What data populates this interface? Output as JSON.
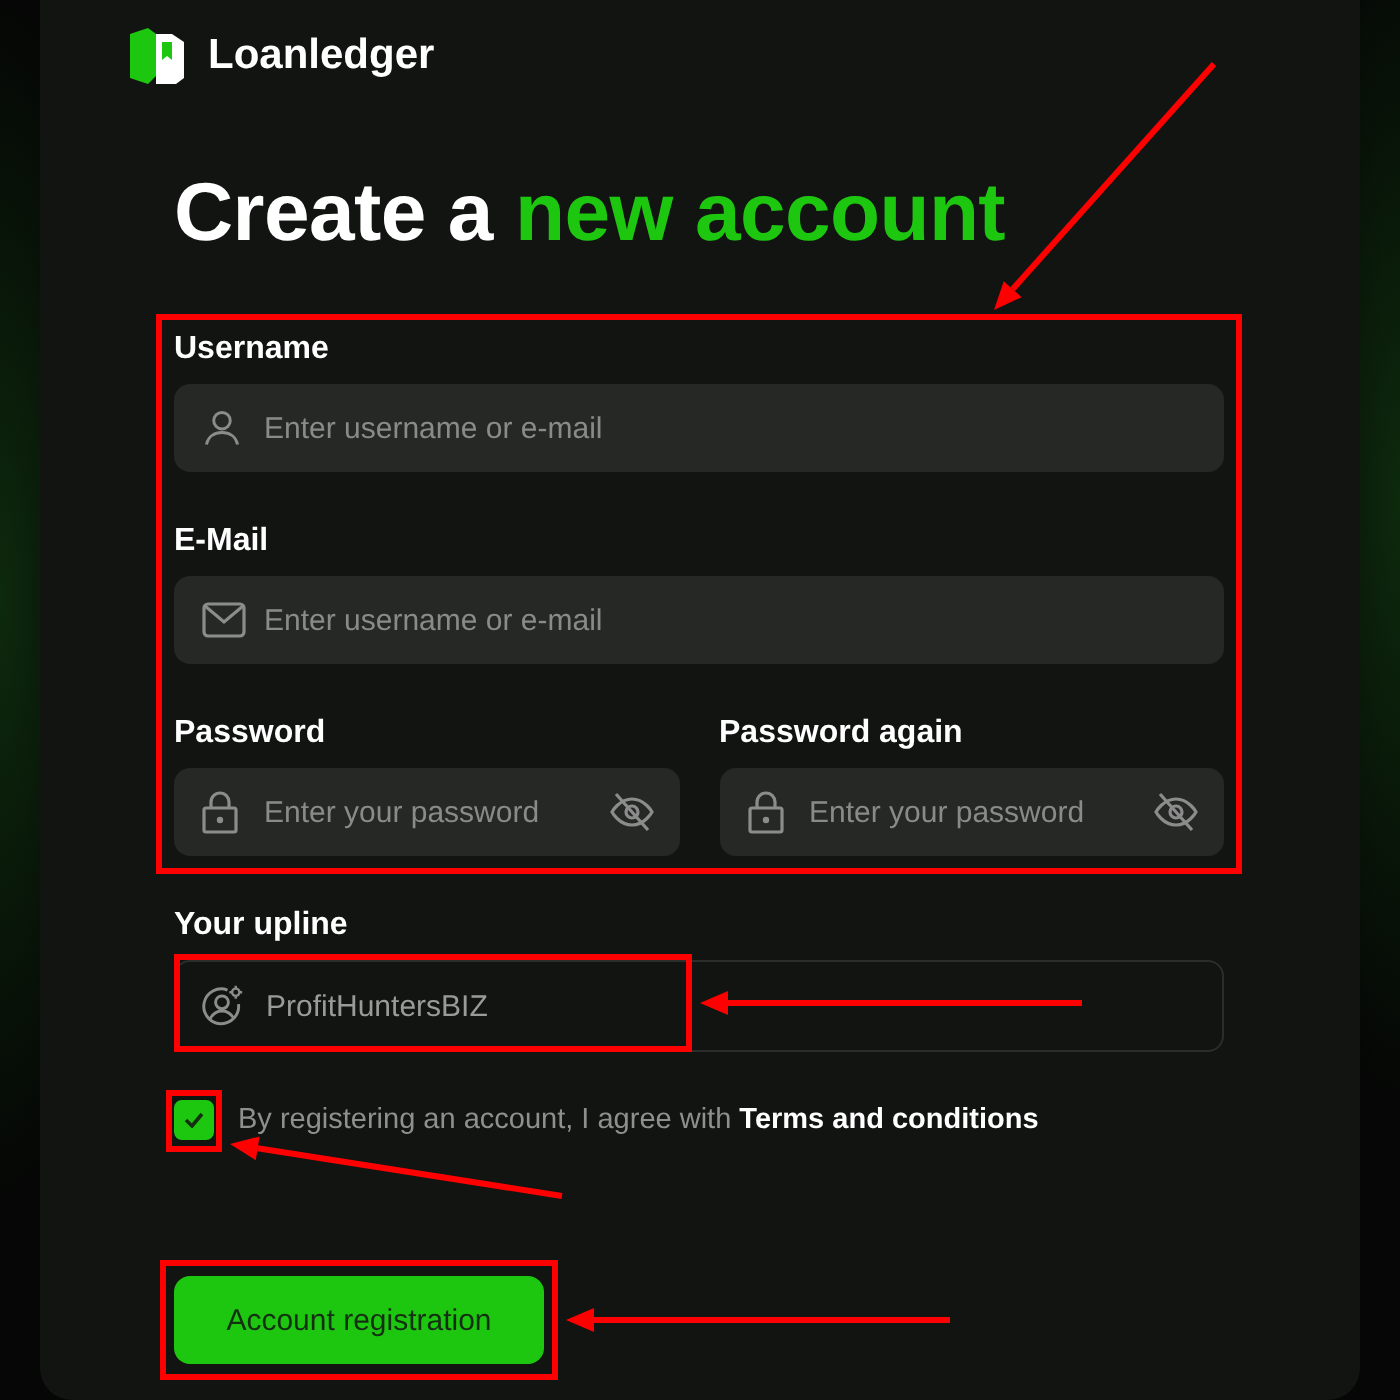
{
  "brand": {
    "name": "Loanledger"
  },
  "heading": {
    "text": "Create a ",
    "highlight": "new account"
  },
  "credentials": {
    "highlighted": true,
    "rows": [
      [
        {
          "kind": "user",
          "label": "Username",
          "placeholder": "Enter username or e-mail"
        }
      ],
      [
        {
          "kind": "mail",
          "label": "E-Mail",
          "placeholder": "Enter username or e-mail"
        }
      ],
      [
        {
          "kind": "password",
          "label": "Password",
          "placeholder": "Enter your password"
        },
        {
          "kind": "password",
          "label": "Password again",
          "placeholder": "Enter your password"
        }
      ]
    ]
  },
  "upline": {
    "kind": "referral",
    "label": "Your upline",
    "value": "ProfitHuntersBIZ",
    "highlighted": true
  },
  "consent": {
    "checked": true,
    "text": "By registering an account, I agree with ",
    "link": "Terms and conditions",
    "highlighted": true
  },
  "submit": {
    "label": "Account registration",
    "highlighted": true
  }
}
